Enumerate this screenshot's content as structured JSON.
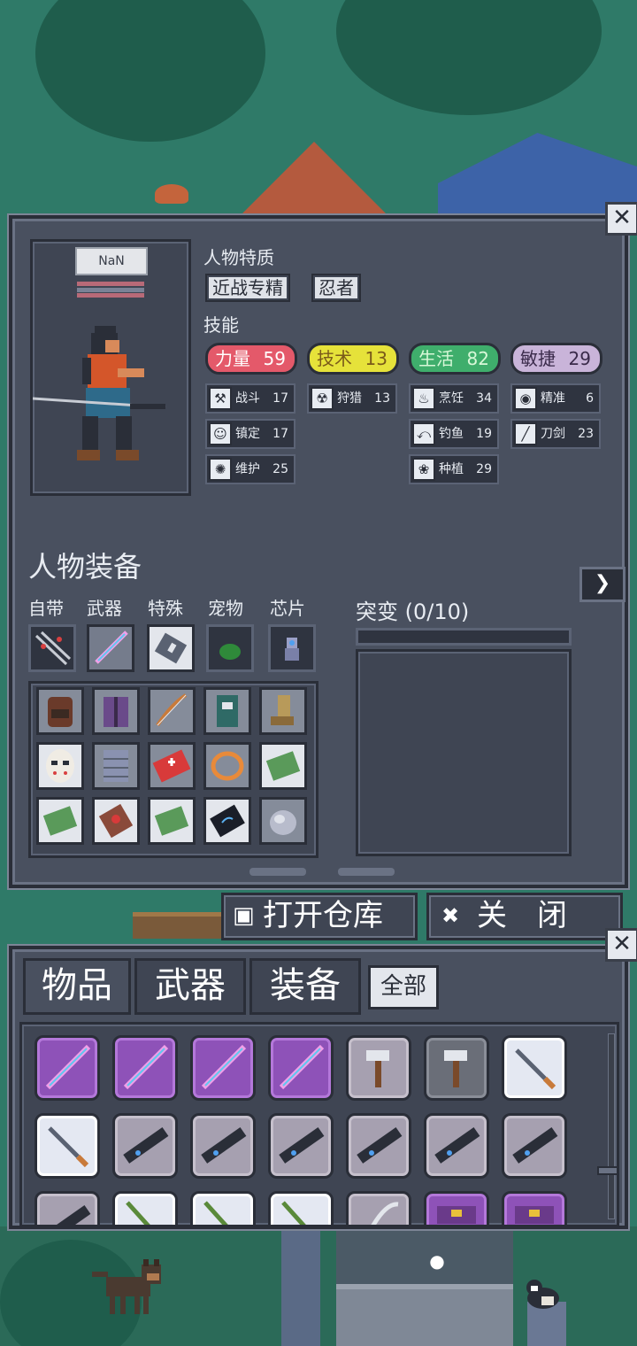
{
  "char_panel": {
    "name": "NaN",
    "traits_label": "人物特质",
    "traits": [
      "近战专精",
      "忍者"
    ],
    "skills_label": "技能",
    "stats": [
      {
        "label": "力量",
        "value": "59",
        "color": "#e4596a"
      },
      {
        "label": "技术",
        "value": "13",
        "color": "#e6e23a"
      },
      {
        "label": "生活",
        "value": "82",
        "color": "#3fae6c"
      },
      {
        "label": "敏捷",
        "value": "29",
        "color": "#c9b4d9"
      }
    ],
    "skills": [
      {
        "name": "战斗",
        "value": "17",
        "icon": "axe-icon"
      },
      {
        "name": "狩猎",
        "value": "13",
        "icon": "radiation-icon"
      },
      {
        "name": "烹饪",
        "value": "34",
        "icon": "cooking-pot-icon"
      },
      {
        "name": "精准",
        "value": "6",
        "icon": "eye-icon"
      },
      {
        "name": "镇定",
        "value": "17",
        "icon": "mask-icon"
      },
      {
        "name": "钓鱼",
        "value": "19",
        "icon": "fishing-icon"
      },
      {
        "name": "刀剑",
        "value": "23",
        "icon": "blade-icon"
      },
      {
        "name": "维护",
        "value": "25",
        "icon": "wrench-icon"
      },
      {
        "name": "种植",
        "value": "29",
        "icon": "plant-icon"
      }
    ],
    "equipment_title": "人物装备",
    "slot_labels": [
      "自带",
      "武器",
      "特殊",
      "宠物",
      "芯片"
    ],
    "mutation_label": "突变 (0/10)"
  },
  "actions": {
    "open_storage": "打开仓库",
    "close": "关　闭"
  },
  "inventory": {
    "tabs": [
      "物品",
      "武器",
      "装备"
    ],
    "filter": "全部"
  }
}
